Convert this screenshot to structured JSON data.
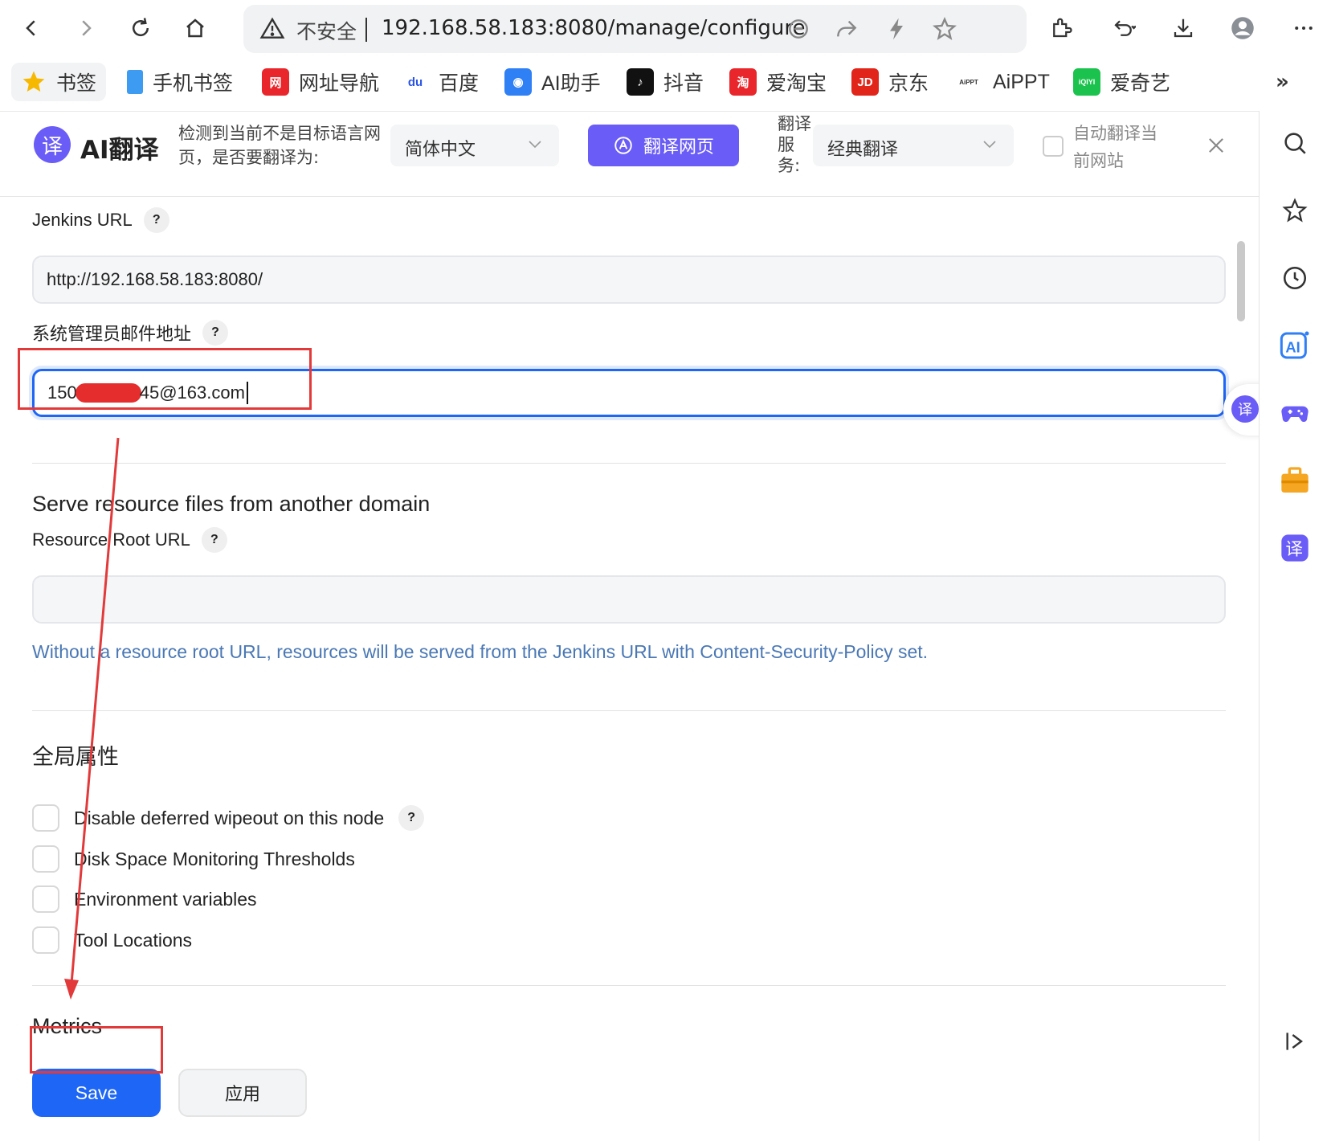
{
  "browser": {
    "address": {
      "security_label": "不安全",
      "url": "192.168.58.183:8080/manage/configure"
    },
    "icons": {
      "back": "back-arrow-icon",
      "forward": "forward-arrow-icon",
      "reload": "reload-icon",
      "home": "home-icon",
      "more": "more-icon"
    }
  },
  "bookmarks": [
    {
      "label": "书签",
      "icon": "star-icon",
      "color": "#f6b800"
    },
    {
      "label": "手机书签",
      "icon": "phone-bookmark-icon",
      "color": "#3d9bf2"
    },
    {
      "label": "网址导航",
      "icon": "nav-icon",
      "color": "#e8262b",
      "glyph": "网"
    },
    {
      "label": "百度",
      "icon": "baidu-icon",
      "color": "#2a54e6",
      "glyph": "du"
    },
    {
      "label": "AI助手",
      "icon": "ai-assistant-icon",
      "color": "#2f7ff5",
      "glyph": "◉"
    },
    {
      "label": "抖音",
      "icon": "douyin-icon",
      "color": "#111111",
      "glyph": "♪"
    },
    {
      "label": "爱淘宝",
      "icon": "taobao-icon",
      "color": "#e8262b",
      "glyph": "淘"
    },
    {
      "label": "京东",
      "icon": "jd-icon",
      "color": "#e1251b",
      "glyph": "JD"
    },
    {
      "label": "AiPPT",
      "icon": "aippt-icon",
      "color": "#333333",
      "glyph": "AiPPT"
    },
    {
      "label": "爱奇艺",
      "icon": "iqiyi-icon",
      "color": "#1bc34e",
      "glyph": "iQIYI"
    }
  ],
  "bookmarks_more": "»",
  "translate_bar": {
    "title": "AI翻译",
    "logo_glyph": "译",
    "description": "检测到当前不是目标语言网页，是否要翻译为:",
    "target_language": "简体中文",
    "translate_button": "翻译网页",
    "service_label": "翻译服务:",
    "service_value": "经典翻译",
    "auto_label": "自动翻译当前网站"
  },
  "form": {
    "jenkins_url": {
      "label": "Jenkins URL",
      "value": "http://192.168.58.183:8080/"
    },
    "admin_email": {
      "label": "系统管理员邮件地址",
      "value_prefix": "150",
      "value_suffix": "45@163.com"
    },
    "resource_section_title": "Serve resource files from another domain",
    "resource_root_url": {
      "label": "Resource Root URL",
      "value": ""
    },
    "resource_hint": "Without a resource root URL, resources will be served from the Jenkins URL with Content-Security-Policy set.",
    "global_properties_title": "全局属性",
    "global_properties": [
      {
        "label": "Disable deferred wipeout on this node",
        "checked": false,
        "has_help": true
      },
      {
        "label": "Disk Space Monitoring Thresholds",
        "checked": false,
        "has_help": false
      },
      {
        "label": "Environment variables",
        "checked": false,
        "has_help": false
      },
      {
        "label": "Tool Locations",
        "checked": false,
        "has_help": false
      }
    ],
    "metrics_title": "Metrics",
    "help_glyph": "?"
  },
  "actions": {
    "save": "Save",
    "apply": "应用"
  },
  "floating_translate_glyph": "译",
  "colors": {
    "accent": "#1e66f5",
    "translate_brand": "#6a5cf6",
    "annotation": "#e23a3a",
    "hint_text": "#4a78b4"
  }
}
